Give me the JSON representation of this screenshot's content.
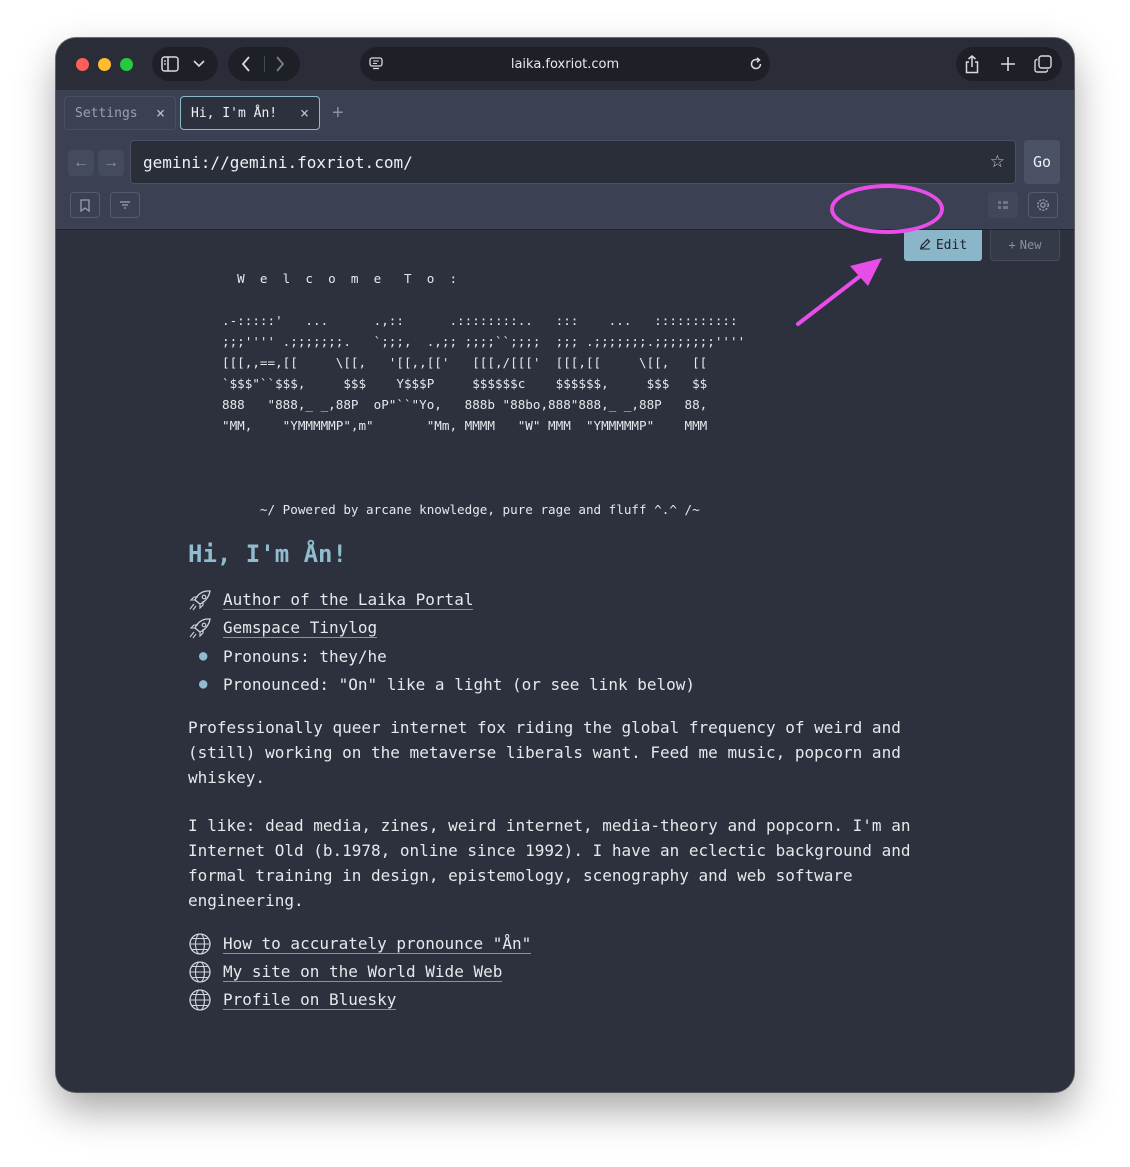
{
  "safari": {
    "address": "laika.foxriot.com"
  },
  "tabs": [
    {
      "label": "Settings"
    },
    {
      "label": "Hi, I'm Ån!"
    }
  ],
  "url": {
    "value": "gemini://gemini.foxriot.com/",
    "go_label": "Go"
  },
  "actions": {
    "edit_label": "Edit",
    "new_label": "New"
  },
  "page": {
    "ascii_art": "  W  e  l  c  o  m  e   T  o  :\n\n.-:::::'   ...      .,::      .::::::::..   :::    ...   :::::::::::\n;;;'''' .;;;;;;;.   `;;;,  .,;; ;;;;``;;;;  ;;; .;;;;;;;.;;;;;;;;''''\n[[[,,==,[[     \\[[,   '[[,,[['   [[[,/[[['  [[[,[[     \\[[,   [[\n`$$$\"``$$$,     $$$    Y$$$P     $$$$$$c    $$$$$$,     $$$   $$\n888   \"888,_ _,88P  oP\"``\"Yo,   888b \"88bo,888\"888,_ _,88P   88,\n\"MM,    \"YMMMMMP\",m\"       \"Mm, MMMM   \"W\" MMM  \"YMMMMMP\"    MMM\n\n\n\n     ~/ Powered by arcane knowledge, pure rage and fluff ^.^ /~",
    "heading": "Hi, I'm Ån!",
    "items": [
      {
        "type": "link",
        "icon": "rocket-icon",
        "text": "Author of the Laika Portal"
      },
      {
        "type": "link",
        "icon": "rocket-icon",
        "text": "Gemspace Tinylog"
      },
      {
        "type": "bullet",
        "text": "Pronouns: they/he"
      },
      {
        "type": "bullet",
        "text": "Pronounced: \"On\" like a light (or see link below)"
      }
    ],
    "paragraphs": [
      "Professionally queer internet fox riding the global frequency of weird and (still) working on the metaverse liberals want. Feed me music, popcorn and whiskey.",
      "I like: dead media, zines, weird internet, media-theory and popcorn. I'm an Internet Old (b.1978, online since 1992). I have an eclectic background and formal training in design, epistemology, scenography and web software engineering."
    ],
    "links": [
      {
        "icon": "globe-icon",
        "text": "How to accurately pronounce \"Ån\""
      },
      {
        "icon": "globe-icon",
        "text": "My site on the World Wide Web"
      },
      {
        "icon": "globe-icon",
        "text": "Profile on Bluesky"
      }
    ]
  },
  "colors": {
    "accent": "#8fbccf",
    "annotation": "#e84de8",
    "background": "#2d313d"
  }
}
